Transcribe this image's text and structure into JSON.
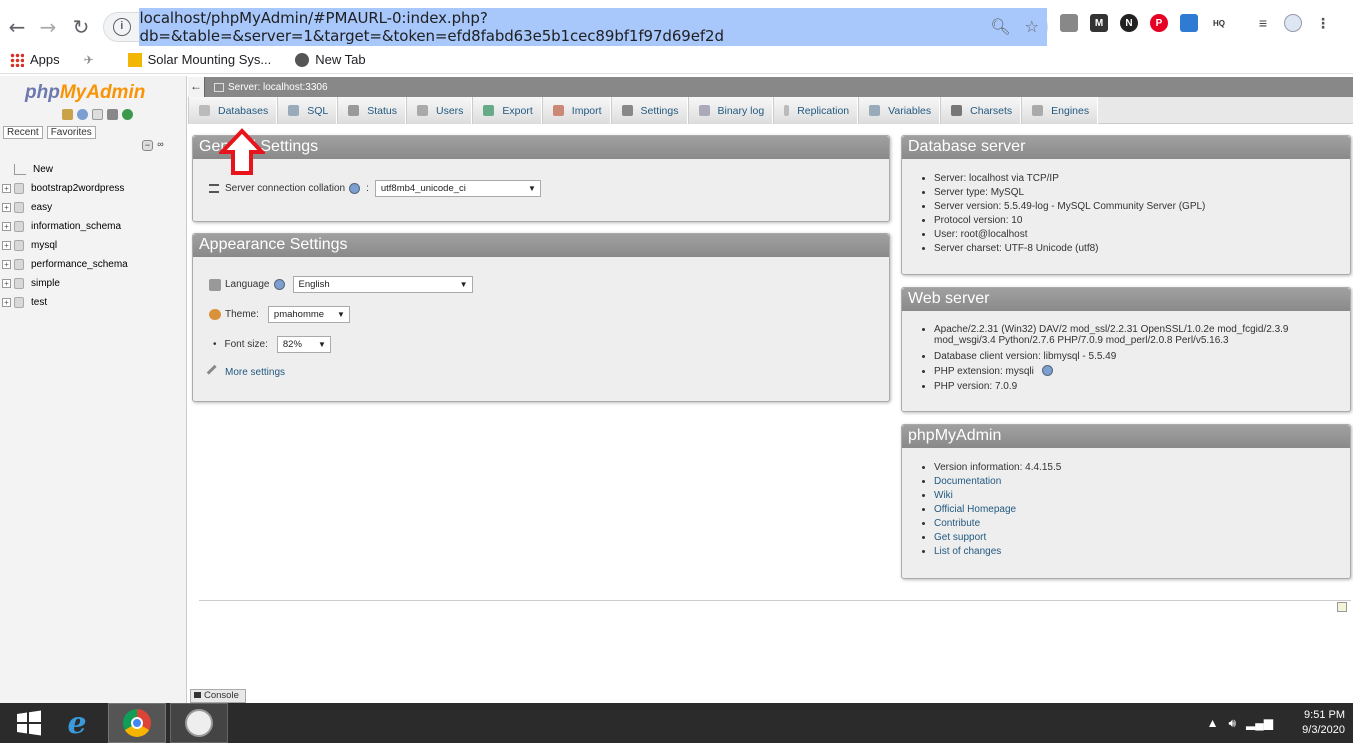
{
  "browser": {
    "url": "localhost/phpMyAdmin/#PMAURL-0:index.php?db=&table=&server=1&target=&token=efd8fabd63e5b1cec89bf1f97d69ef2d",
    "bookmarks": [
      "Apps",
      "Solar Mounting Sys...",
      "New Tab"
    ]
  },
  "left": {
    "logo_a": "php",
    "logo_b": "MyAdmin",
    "tabs": [
      "Recent",
      "Favorites"
    ],
    "databases": [
      "New",
      "bootstrap2wordpress",
      "easy",
      "information_schema",
      "mysql",
      "performance_schema",
      "simple",
      "test"
    ]
  },
  "server_bar": {
    "label": "Server: localhost:3306"
  },
  "menu": [
    "Databases",
    "SQL",
    "Status",
    "Users",
    "Export",
    "Import",
    "Settings",
    "Binary log",
    "Replication",
    "Variables",
    "Charsets",
    "Engines"
  ],
  "general": {
    "title": "General Settings",
    "collation_label": "Server connection collation",
    "collation_value": "utf8mb4_unicode_ci"
  },
  "appearance": {
    "title": "Appearance Settings",
    "language_label": "Language",
    "language_value": "English",
    "theme_label": "Theme:",
    "theme_value": "pmahomme",
    "fontsize_label": "Font size:",
    "fontsize_value": "82%",
    "more": "More settings"
  },
  "db_server": {
    "title": "Database server",
    "items": [
      "Server: localhost via TCP/IP",
      "Server type: MySQL",
      "Server version: 5.5.49-log - MySQL Community Server (GPL)",
      "Protocol version: 10",
      "User: root@localhost",
      "Server charset: UTF-8 Unicode (utf8)"
    ]
  },
  "web_server": {
    "title": "Web server",
    "apache_line1": "Apache/2.2.31 (Win32) DAV/2 mod_ssl/2.2.31 OpenSSL/1.0.2e mod_fcgid/2.3.9",
    "apache_line2": "mod_wsgi/3.4 Python/2.7.6 PHP/7.0.9 mod_perl/2.0.8 Perl/v5.16.3",
    "items": [
      "Database client version: libmysql - 5.5.49",
      "PHP extension: mysqli",
      "PHP version: 7.0.9"
    ]
  },
  "pma": {
    "title": "phpMyAdmin",
    "version": "Version information: 4.4.15.5",
    "links": [
      "Documentation",
      "Wiki",
      "Official Homepage",
      "Contribute",
      "Get support",
      "List of changes"
    ]
  },
  "console": "Console",
  "taskbar": {
    "time": "9:51 PM",
    "date": "9/3/2020"
  },
  "colors": {
    "annotation_arrow": "#e8141b",
    "link": "#235a81"
  }
}
